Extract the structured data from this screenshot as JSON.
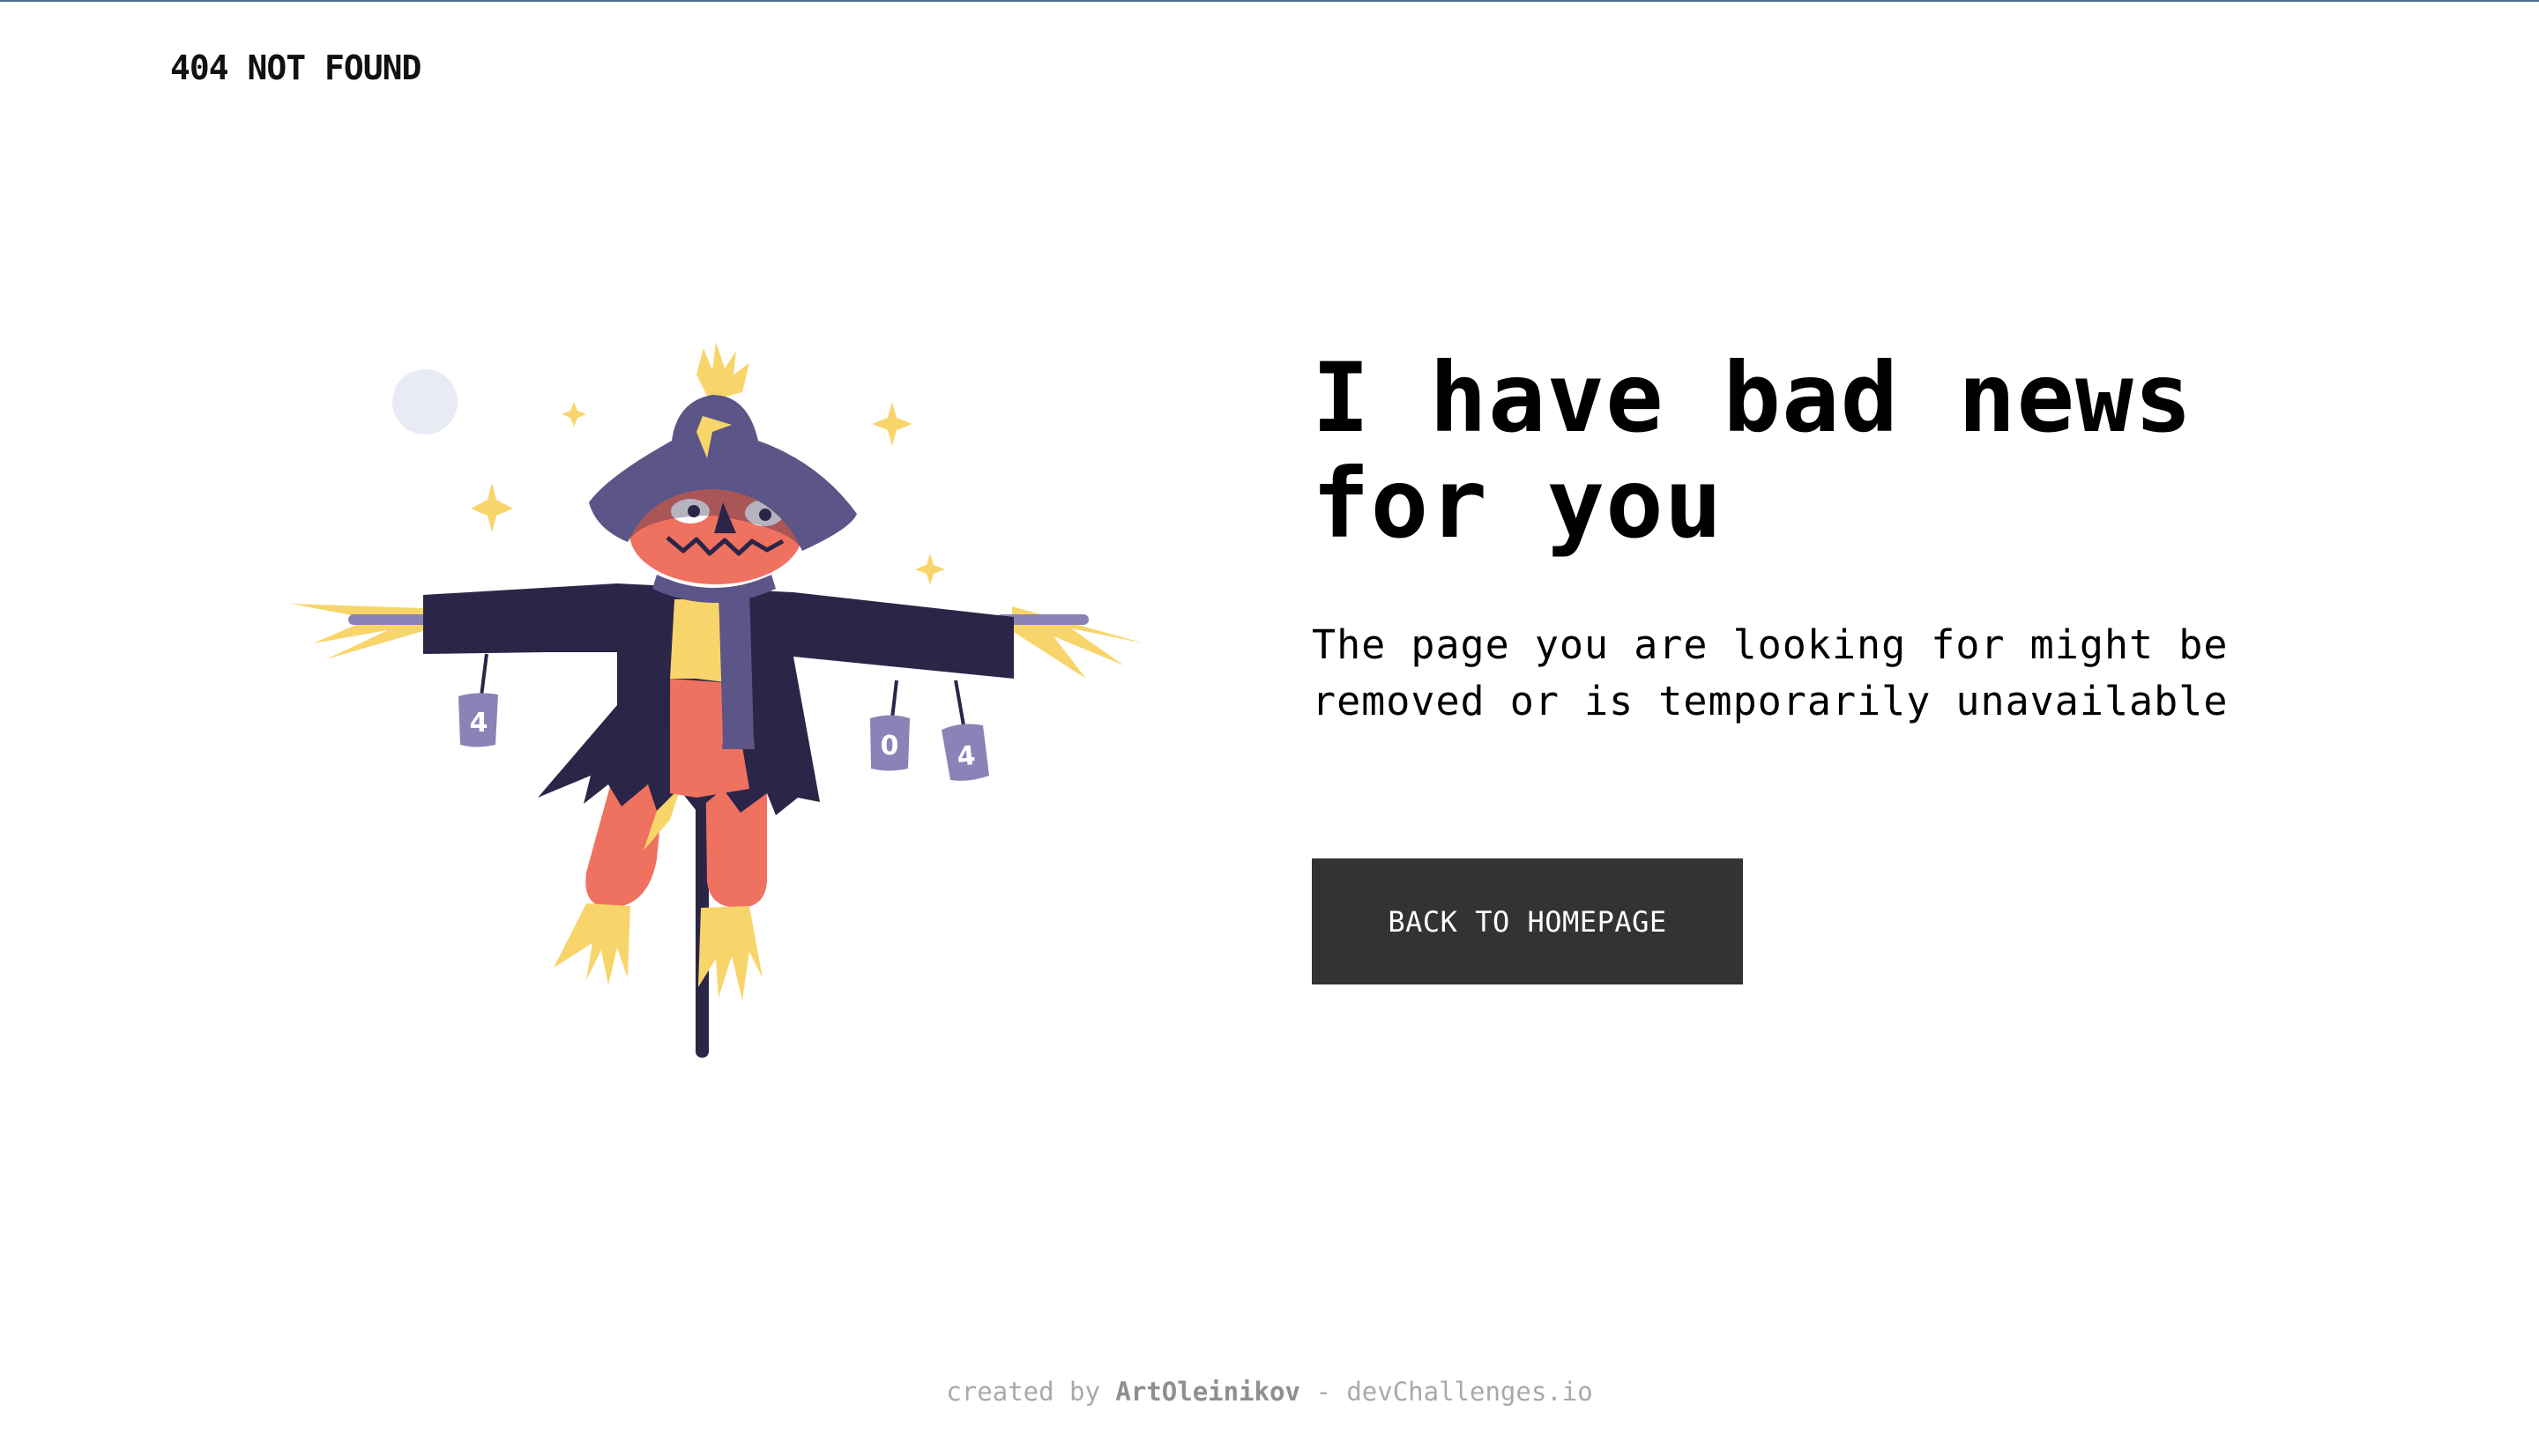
{
  "header": {
    "brand": "404 NOT FOUND"
  },
  "hero": {
    "illustration_alt": "scarecrow",
    "cans": [
      "4",
      "0",
      "4"
    ],
    "headline": "I have bad news for you",
    "description": "The page you are looking for might be removed or is temporarily unavailable",
    "button_label": "BACK TO HOMEPAGE"
  },
  "footer": {
    "prefix": "created by",
    "author": "ArtOleinikov",
    "separator": "-",
    "site": "devChallenges.io"
  },
  "colors": {
    "page_background": "#ffffff",
    "text": "#000000",
    "button_background": "#333333",
    "button_text": "#ffffff",
    "footer_text": "#a9a9a9",
    "coat": "#2b2548",
    "hat": "#5c5587",
    "face": "#ef7160",
    "straw": "#f8d56b",
    "can": "#8b83b7",
    "moon": "#e8eaf4"
  }
}
